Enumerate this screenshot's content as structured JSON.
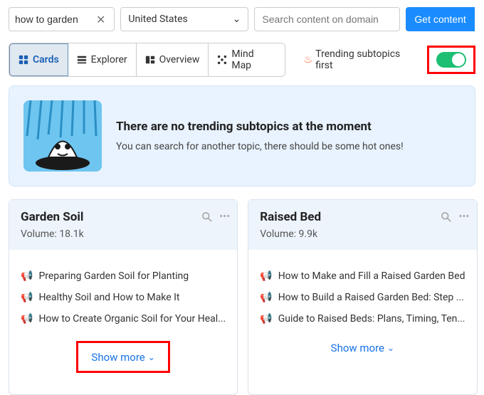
{
  "search": {
    "query": "how to garden",
    "country": "United States",
    "domain_placeholder": "Search content on domain",
    "button": "Get content"
  },
  "tabs": {
    "cards": "Cards",
    "explorer": "Explorer",
    "overview": "Overview",
    "mindmap": "Mind Map"
  },
  "trending_label": "Trending subtopics first",
  "banner": {
    "title": "There are no trending subtopics at the moment",
    "desc": "You can search for another topic, there should be some hot ones!"
  },
  "cards": [
    {
      "title": "Garden Soil",
      "volume_label": "Volume:",
      "volume": "18.1k",
      "items": [
        "Preparing Garden Soil for Planting",
        "Healthy Soil and How to Make It",
        "How to Create Organic Soil for Your Heal..."
      ],
      "show_more": "Show more"
    },
    {
      "title": "Raised Bed",
      "volume_label": "Volume:",
      "volume": "9.9k",
      "items": [
        "How to Make and Fill a Raised Garden Bed",
        "How to Build a Raised Garden Bed: Step ...",
        "Guide to Raised Beds: Plans, Timing, Ten..."
      ],
      "show_more": "Show more"
    }
  ]
}
